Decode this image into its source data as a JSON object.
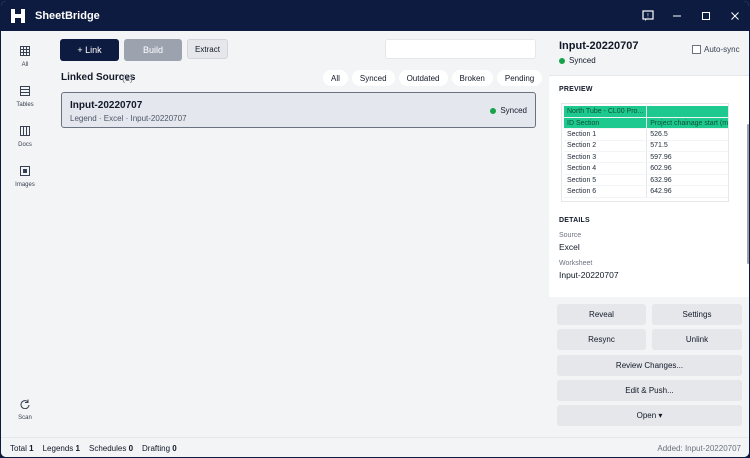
{
  "app": {
    "title": "SheetBridge"
  },
  "toolbar": {
    "link_label": "+ Link",
    "build_label": "Build",
    "extract_label": "Extract",
    "search_placeholder": ""
  },
  "sidebar": {
    "items": [
      {
        "label": "All",
        "icon": "grid-icon"
      },
      {
        "label": "Tables",
        "icon": "table-icon"
      },
      {
        "label": "Docs",
        "icon": "docs-icon"
      },
      {
        "label": "Images",
        "icon": "image-icon"
      },
      {
        "label": "Scan",
        "icon": "refresh-icon"
      }
    ]
  },
  "linked": {
    "title": "Linked Sources",
    "count": "(1)",
    "filters": [
      "All",
      "Synced",
      "Outdated",
      "Broken",
      "Pending"
    ]
  },
  "card": {
    "title": "Input-20220707",
    "subtitle": "Legend · Excel · Input-20220707",
    "status": "Synced",
    "status_color": "#16a34a"
  },
  "detail": {
    "title": "Input-20220707",
    "status": "Synced",
    "autosync_label": "Auto-sync",
    "preview_title": "PREVIEW",
    "preview_rows": [
      [
        "North Tube - CL00 Pro...",
        ""
      ],
      [
        "ID Section",
        "Project chainage start (m"
      ],
      [
        "Section 1",
        "526.5"
      ],
      [
        "Section 2",
        "571.5"
      ],
      [
        "Section 3",
        "597.96"
      ],
      [
        "Section 4",
        "602.96"
      ],
      [
        "Section 5",
        "632.96"
      ],
      [
        "Section 6",
        "642.96"
      ]
    ],
    "details_title": "DETAILS",
    "source_label": "Source",
    "source_value": "Excel",
    "worksheet_label": "Worksheet",
    "worksheet_value": "Input-20220707"
  },
  "actions": {
    "reveal": "Reveal",
    "settings": "Settings",
    "resync": "Resync",
    "unlink": "Unlink",
    "review": "Review Changes...",
    "edit_push": "Edit & Push...",
    "open": "Open ▾"
  },
  "statusbar": {
    "total_label": "Total",
    "total_value": "1",
    "legends_label": "Legends",
    "legends_value": "1",
    "schedules_label": "Schedules",
    "schedules_value": "0",
    "drafting_label": "Drafting",
    "drafting_value": "0",
    "added": "Added: Input-20220707"
  },
  "colors": {
    "titlebar": "#0e1b40",
    "accent": "#0e1b40",
    "highlight": "#1ec98f",
    "synced": "#16a34a"
  }
}
